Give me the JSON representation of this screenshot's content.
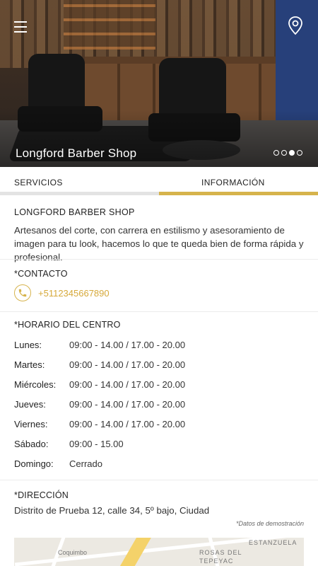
{
  "hero": {
    "title": "Longford Barber Shop",
    "menu_icon": "hamburger-menu-icon",
    "map_icon": "map-pin-icon",
    "carousel": {
      "total": 4,
      "active": 3
    }
  },
  "tabs": [
    {
      "label": "SERVICIOS",
      "active": false
    },
    {
      "label": "INFORMACIÓN",
      "active": true
    }
  ],
  "business": {
    "name": "LONGFORD BARBER SHOP",
    "description": "Artesanos del corte, con carrera en estilismo y asesoramiento de imagen para tu look, hacemos lo que te queda bien de forma rápida y profesional."
  },
  "contact": {
    "title": "*CONTACTO",
    "phone": "+5112345667890",
    "icon": "phone-icon"
  },
  "schedule": {
    "title": "*HORARIO DEL CENTRO",
    "rows": [
      {
        "day": "Lunes:",
        "time": "09:00 - 14.00  /  17.00 - 20.00"
      },
      {
        "day": "Martes:",
        "time": "09:00 - 14.00  /  17.00 - 20.00"
      },
      {
        "day": "Miércoles:",
        "time": "09:00 - 14.00  /  17.00 - 20.00"
      },
      {
        "day": "Jueves:",
        "time": "09:00 - 14.00  /  17.00 - 20.00"
      },
      {
        "day": "Viernes:",
        "time": "09:00 - 14.00  /  17.00 - 20.00"
      },
      {
        "day": "Sábado:",
        "time": "09:00 - 15.00"
      },
      {
        "day": "Domingo:",
        "time": "Cerrado"
      }
    ]
  },
  "address": {
    "title": "*DIRECCIÓN",
    "text": "Distrito de Prueba 12, calle 34, 5º bajo, Ciudad",
    "demo_note": "*Datos de demostración"
  },
  "map": {
    "labels": [
      "Coquimbo",
      "ROSAS DEL",
      "TEPEYAC",
      "ESTANZUELA"
    ]
  },
  "colors": {
    "accent": "#d6b34c",
    "tab_inactive": "#e3e3e3"
  }
}
